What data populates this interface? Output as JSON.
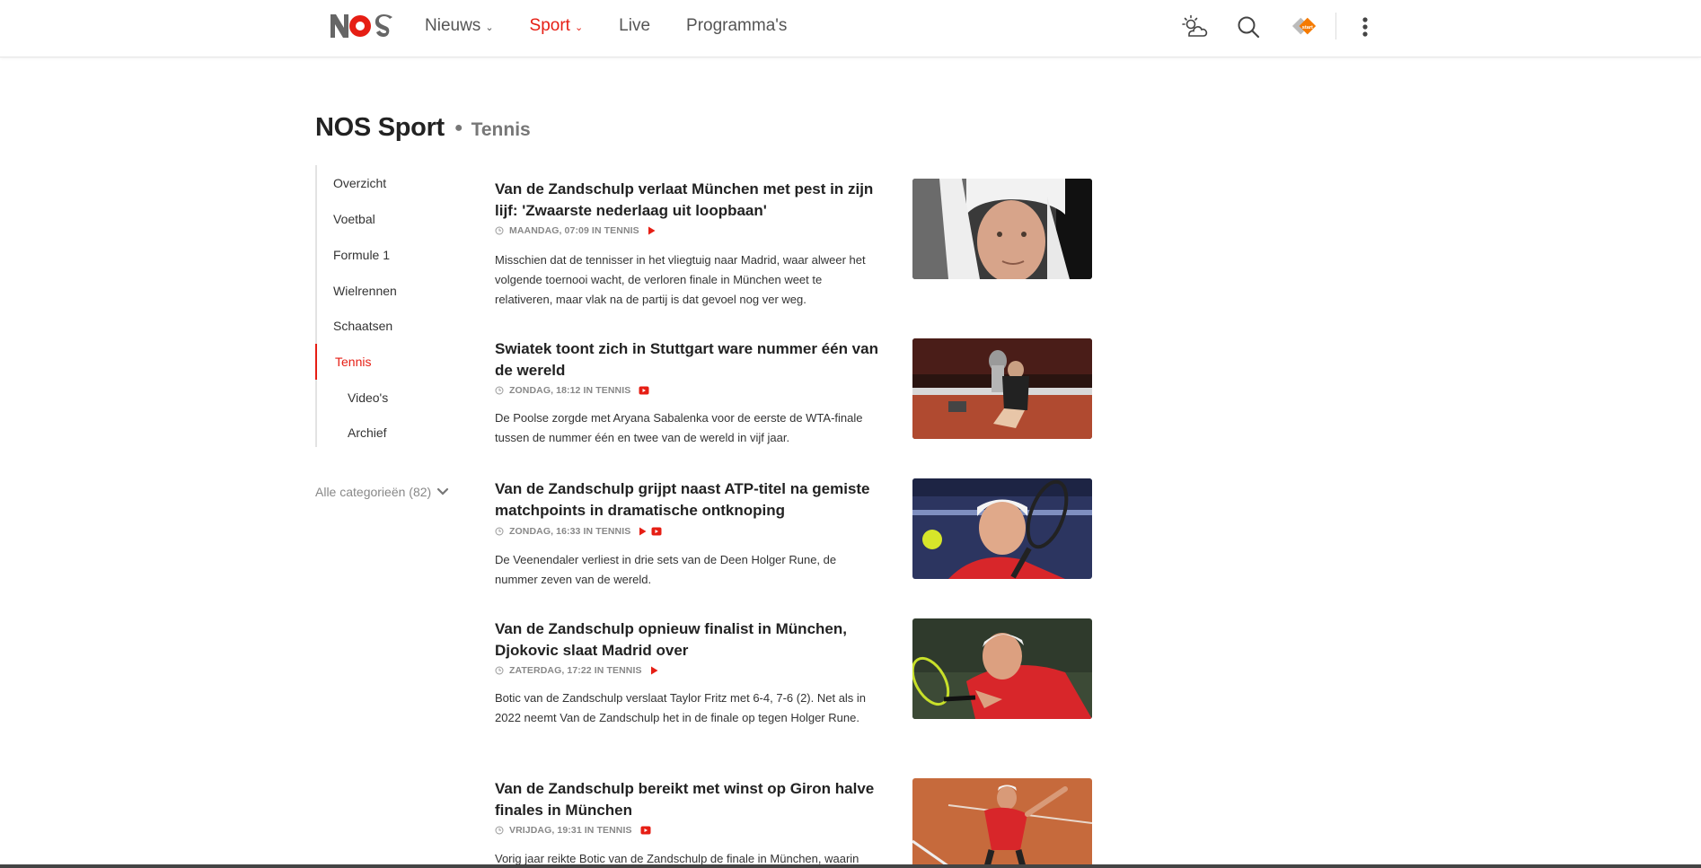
{
  "header": {
    "logo_text": "NOS",
    "nav": [
      {
        "label": "Nieuws",
        "has_dropdown": true,
        "active": false
      },
      {
        "label": "Sport",
        "has_dropdown": true,
        "active": true
      },
      {
        "label": "Live",
        "has_dropdown": false,
        "active": false
      },
      {
        "label": "Programma's",
        "has_dropdown": false,
        "active": false
      }
    ],
    "tools": [
      "weather-icon",
      "search-icon",
      "npo-start-icon",
      "more-icon"
    ],
    "npo_badge_text": "start"
  },
  "page": {
    "title": "NOS Sport",
    "subtitle": "Tennis"
  },
  "sidebar": {
    "items": [
      {
        "label": "Overzicht",
        "active": false,
        "sub": false
      },
      {
        "label": "Voetbal",
        "active": false,
        "sub": false
      },
      {
        "label": "Formule 1",
        "active": false,
        "sub": false
      },
      {
        "label": "Wielrennen",
        "active": false,
        "sub": false
      },
      {
        "label": "Schaatsen",
        "active": false,
        "sub": false
      },
      {
        "label": "Tennis",
        "active": true,
        "sub": false
      },
      {
        "label": "Video's",
        "active": false,
        "sub": true
      },
      {
        "label": "Archief",
        "active": false,
        "sub": true
      }
    ],
    "all_categories": "Alle categorieën (82)"
  },
  "articles": [
    {
      "title": "Van de Zandschulp verlaat München met pest in zijn lijf: 'Zwaarste nederlaag uit loopbaan'",
      "meta": "MAANDAG, 07:09 IN TENNIS",
      "icons": [
        "play-icon"
      ],
      "description": "Misschien dat de tennisser in het vliegtuig naar Madrid, waar alweer het volgende toernooi wacht, de verloren finale in München weet te relativeren, maar vlak na de partij is dat gevoel nog ver weg."
    },
    {
      "title": "Swiatek toont zich in Stuttgart ware nummer één van de wereld",
      "meta": "ZONDAG, 18:12 IN TENNIS",
      "icons": [
        "video-icon"
      ],
      "description": "De Poolse zorgde met Aryana Sabalenka voor de eerste de WTA-finale tussen de nummer één en twee van de wereld in vijf jaar."
    },
    {
      "title": "Van de Zandschulp grijpt naast ATP-titel na gemiste matchpoints in dramatische ontknoping",
      "meta": "ZONDAG, 16:33 IN TENNIS",
      "icons": [
        "play-icon",
        "video-icon"
      ],
      "description": "De Veenendaler verliest in drie sets van de Deen Holger Rune, de nummer zeven van de wereld."
    },
    {
      "title": "Van de Zandschulp opnieuw finalist in München, Djokovic slaat Madrid over",
      "meta": "ZATERDAG, 17:22 IN TENNIS",
      "icons": [
        "play-icon"
      ],
      "description": "Botic van de Zandschulp verslaat Taylor Fritz met 6-4, 7-6 (2). Net als in 2022 neemt Van de Zandschulp het in de finale op tegen Holger Rune."
    },
    {
      "title": "Van de Zandschulp bereikt met winst op Giron halve finales in München",
      "meta": "VRIJDAG, 19:31 IN TENNIS",
      "icons": [
        "video-icon"
      ],
      "description": "Vorig jaar reikte Botic van de Zandschulp de finale in München, waarin"
    }
  ],
  "colors": {
    "accent": "#e61e14",
    "text": "#222222",
    "muted": "#888888"
  }
}
